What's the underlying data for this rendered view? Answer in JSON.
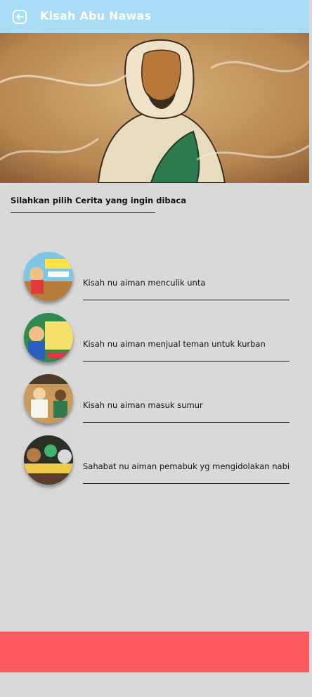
{
  "appbar": {
    "title": "Kisah Abu Nawas",
    "back_icon": "arrow-left-circle-icon",
    "background": "#a8dcf7"
  },
  "hero": {
    "alt": "Abu Nawas character illustration"
  },
  "section": {
    "title": "Silahkan pilih Cerita yang ingin dibaca"
  },
  "stories": [
    {
      "label": "Kisah nu aiman  menculik unta"
    },
    {
      "label": "Kisah nu aiman menjual teman untuk kurban"
    },
    {
      "label": "Kisah nu aiman masuk sumur"
    },
    {
      "label": "Sahabat nu aiman pemabuk yg mengidolakan nabi"
    }
  ],
  "colors": {
    "background": "#d9d9d9",
    "bottom_bar": "#ff5a5f"
  }
}
